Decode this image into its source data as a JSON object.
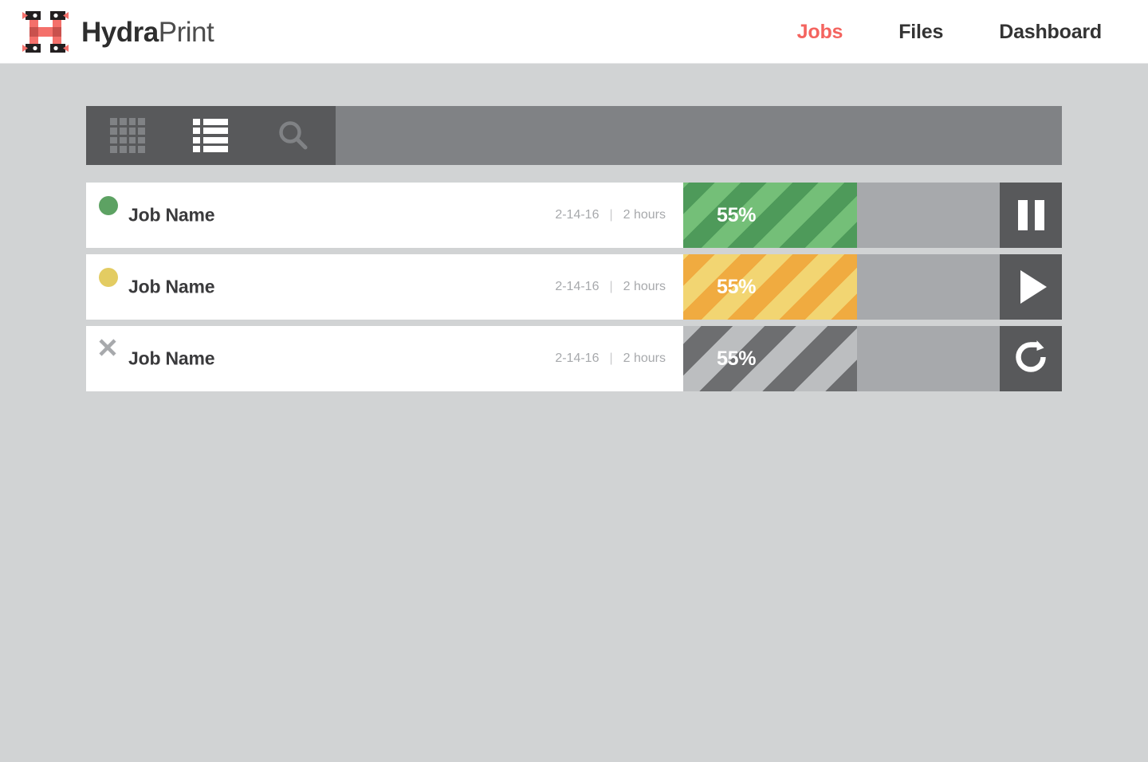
{
  "brand": {
    "name_bold": "Hydra",
    "name_light": "Print",
    "logo_icon": "hydraprint-h-cropmarks-logo",
    "accent_color": "#f4645f"
  },
  "nav": {
    "items": [
      {
        "label": "Jobs",
        "active": true
      },
      {
        "label": "Files",
        "active": false
      },
      {
        "label": "Dashboard",
        "active": false
      }
    ]
  },
  "toolbar": {
    "buttons": [
      {
        "icon": "grid-view-icon",
        "label": "Grid view",
        "active": false
      },
      {
        "icon": "list-view-icon",
        "label": "List view",
        "active": true
      },
      {
        "icon": "search-icon",
        "label": "Search",
        "active": false
      }
    ],
    "icon_panel_color": "#58595b",
    "bar_color": "#808285"
  },
  "jobs": {
    "rows": [
      {
        "name": "Job Name",
        "date": "2-14-16",
        "separator": "|",
        "duration": "2 hours",
        "status": "running",
        "status_icon": "status-dot-green",
        "status_color": "#5da263",
        "progress_percent": "55%",
        "progress_value": 55,
        "stripe_color_a": "#4e9a5a",
        "stripe_color_b": "#74bf78",
        "track_color": "#a7a9ac",
        "action_icon": "pause-icon",
        "action_label": "Pause"
      },
      {
        "name": "Job Name",
        "date": "2-14-16",
        "separator": "|",
        "duration": "2 hours",
        "status": "paused",
        "status_icon": "status-dot-yellow",
        "status_color": "#e3cc62",
        "progress_percent": "55%",
        "progress_value": 55,
        "stripe_color_a": "#f0ab40",
        "stripe_color_b": "#f2d572",
        "track_color": "#a7a9ac",
        "action_icon": "play-icon",
        "action_label": "Resume"
      },
      {
        "name": "Job Name",
        "date": "2-14-16",
        "separator": "|",
        "duration": "2 hours",
        "status": "cancelled",
        "status_icon": "status-x-gray",
        "status_color": "#a7a9ac",
        "progress_percent": "55%",
        "progress_value": 55,
        "stripe_color_a": "#6d6e70",
        "stripe_color_b": "#bcbec0",
        "track_color": "#a7a9ac",
        "action_icon": "restart-icon",
        "action_label": "Restart"
      }
    ]
  },
  "page": {
    "background_color": "#d1d3d4",
    "header_background": "#ffffff",
    "card_background": "#ffffff"
  }
}
